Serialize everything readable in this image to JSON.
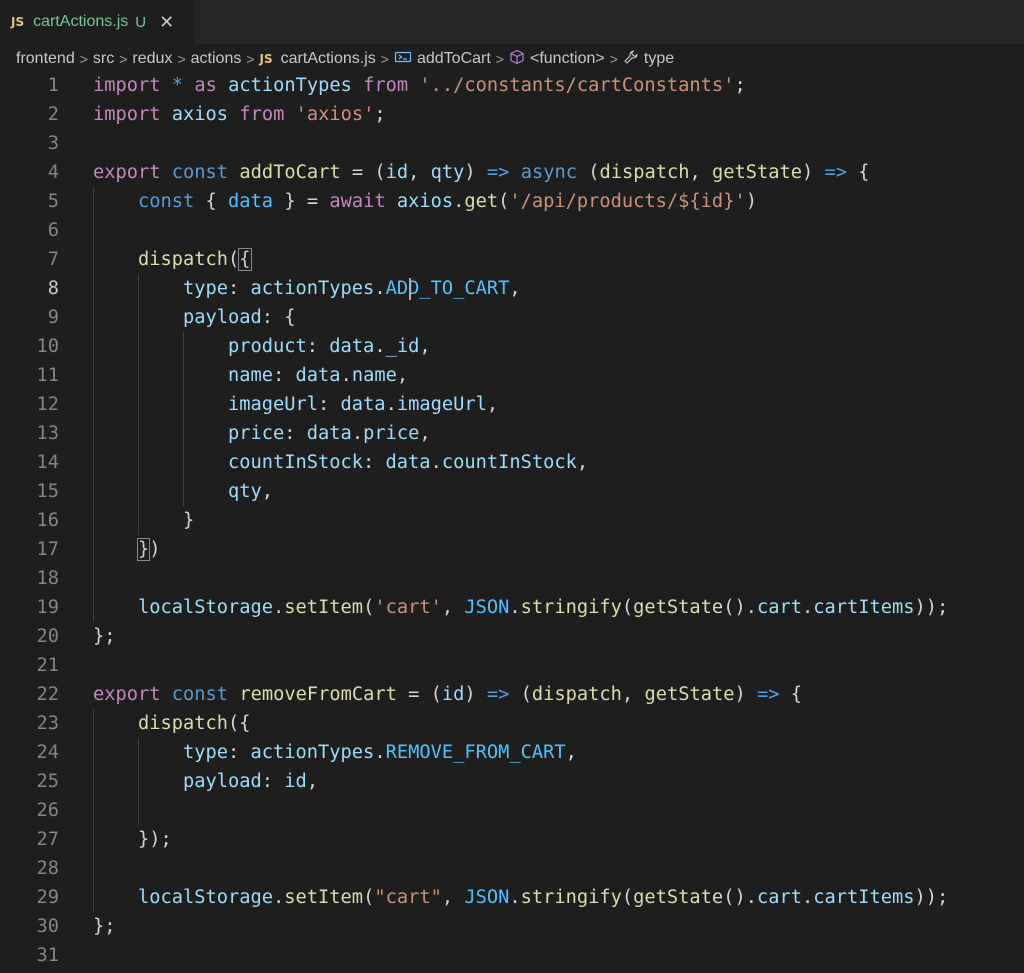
{
  "tab": {
    "lang": "JS",
    "filename": "cartActions.js",
    "status": "U",
    "close": "✕"
  },
  "breadcrumb": [
    "frontend",
    "src",
    "redux",
    "actions",
    "cartActions.js",
    "addToCart",
    "<function>",
    "type"
  ],
  "breadcrumb_sep": ">",
  "breadcrumb_js": "JS",
  "icons": {
    "symbol": "variable-icon",
    "function": "cube-icon",
    "property": "wrench-icon"
  },
  "editor": {
    "active_line": 8,
    "line_numbers": [
      "1",
      "2",
      "3",
      "4",
      "5",
      "6",
      "7",
      "8",
      "9",
      "10",
      "11",
      "12",
      "13",
      "14",
      "15",
      "16",
      "17",
      "18",
      "19",
      "20",
      "21",
      "22",
      "23",
      "24",
      "25",
      "26",
      "27",
      "28",
      "29",
      "30",
      "31"
    ],
    "lines": [
      [
        [
          "kw",
          "import"
        ],
        [
          "tx",
          " "
        ],
        [
          "sk",
          "*"
        ],
        [
          "tx",
          " "
        ],
        [
          "kw",
          "as"
        ],
        [
          "tx",
          " "
        ],
        [
          "vr",
          "actionTypes"
        ],
        [
          "tx",
          " "
        ],
        [
          "kw",
          "from"
        ],
        [
          "tx",
          " "
        ],
        [
          "str",
          "'../constants/cartConstants'"
        ],
        [
          "tx",
          ";"
        ]
      ],
      [
        [
          "kw",
          "import"
        ],
        [
          "tx",
          " "
        ],
        [
          "vr",
          "axios"
        ],
        [
          "tx",
          " "
        ],
        [
          "kw",
          "from"
        ],
        [
          "tx",
          " "
        ],
        [
          "str",
          "'axios'"
        ],
        [
          "tx",
          ";"
        ]
      ],
      [],
      [
        [
          "kw",
          "export"
        ],
        [
          "tx",
          " "
        ],
        [
          "sk",
          "const"
        ],
        [
          "tx",
          " "
        ],
        [
          "fn",
          "addToCart"
        ],
        [
          "tx",
          " = ("
        ],
        [
          "vr",
          "id"
        ],
        [
          "tx",
          ", "
        ],
        [
          "vr",
          "qty"
        ],
        [
          "tx",
          ") "
        ],
        [
          "sk",
          "=>"
        ],
        [
          "tx",
          " "
        ],
        [
          "sk",
          "async"
        ],
        [
          "tx",
          " ("
        ],
        [
          "fn",
          "dispatch"
        ],
        [
          "tx",
          ", "
        ],
        [
          "fn",
          "getState"
        ],
        [
          "tx",
          ") "
        ],
        [
          "sk",
          "=>"
        ],
        [
          "tx",
          " {"
        ]
      ],
      [
        [
          "tx",
          "    "
        ],
        [
          "sk",
          "const"
        ],
        [
          "tx",
          " { "
        ],
        [
          "cn",
          "data"
        ],
        [
          "tx",
          " } = "
        ],
        [
          "kw",
          "await"
        ],
        [
          "tx",
          " "
        ],
        [
          "vr",
          "axios"
        ],
        [
          "tx",
          "."
        ],
        [
          "fn",
          "get"
        ],
        [
          "tx",
          "("
        ],
        [
          "str",
          "'/api/products/${id}'"
        ],
        [
          "tx",
          ")"
        ]
      ],
      [],
      [
        [
          "tx",
          "    "
        ],
        [
          "fn",
          "dispatch"
        ],
        [
          "tx",
          "("
        ],
        [
          "bm",
          "{"
        ]
      ],
      [
        [
          "tx",
          "        "
        ],
        [
          "vr",
          "type"
        ],
        [
          "tx",
          ": "
        ],
        [
          "vr",
          "actionTypes"
        ],
        [
          "tx",
          "."
        ],
        [
          "cn",
          "ADD_TO_CART"
        ],
        [
          "tx",
          ","
        ]
      ],
      [
        [
          "tx",
          "        "
        ],
        [
          "vr",
          "payload"
        ],
        [
          "tx",
          ": {"
        ]
      ],
      [
        [
          "tx",
          "            "
        ],
        [
          "vr",
          "product"
        ],
        [
          "tx",
          ": "
        ],
        [
          "vr",
          "data"
        ],
        [
          "tx",
          "."
        ],
        [
          "vr",
          "_id"
        ],
        [
          "tx",
          ","
        ]
      ],
      [
        [
          "tx",
          "            "
        ],
        [
          "vr",
          "name"
        ],
        [
          "tx",
          ": "
        ],
        [
          "vr",
          "data"
        ],
        [
          "tx",
          "."
        ],
        [
          "vr",
          "name"
        ],
        [
          "tx",
          ","
        ]
      ],
      [
        [
          "tx",
          "            "
        ],
        [
          "vr",
          "imageUrl"
        ],
        [
          "tx",
          ": "
        ],
        [
          "vr",
          "data"
        ],
        [
          "tx",
          "."
        ],
        [
          "vr",
          "imageUrl"
        ],
        [
          "tx",
          ","
        ]
      ],
      [
        [
          "tx",
          "            "
        ],
        [
          "vr",
          "price"
        ],
        [
          "tx",
          ": "
        ],
        [
          "vr",
          "data"
        ],
        [
          "tx",
          "."
        ],
        [
          "vr",
          "price"
        ],
        [
          "tx",
          ","
        ]
      ],
      [
        [
          "tx",
          "            "
        ],
        [
          "vr",
          "countInStock"
        ],
        [
          "tx",
          ": "
        ],
        [
          "vr",
          "data"
        ],
        [
          "tx",
          "."
        ],
        [
          "vr",
          "countInStock"
        ],
        [
          "tx",
          ","
        ]
      ],
      [
        [
          "tx",
          "            "
        ],
        [
          "vr",
          "qty"
        ],
        [
          "tx",
          ","
        ]
      ],
      [
        [
          "tx",
          "        }"
        ]
      ],
      [
        [
          "tx",
          "    "
        ],
        [
          "bm",
          "}"
        ],
        [
          "tx",
          ")"
        ]
      ],
      [],
      [
        [
          "tx",
          "    "
        ],
        [
          "vr",
          "localStorage"
        ],
        [
          "tx",
          "."
        ],
        [
          "fn",
          "setItem"
        ],
        [
          "tx",
          "("
        ],
        [
          "str",
          "'cart'"
        ],
        [
          "tx",
          ", "
        ],
        [
          "cn",
          "JSON"
        ],
        [
          "tx",
          "."
        ],
        [
          "fn",
          "stringify"
        ],
        [
          "tx",
          "("
        ],
        [
          "fn",
          "getState"
        ],
        [
          "tx",
          "()."
        ],
        [
          "vr",
          "cart"
        ],
        [
          "tx",
          "."
        ],
        [
          "vr",
          "cartItems"
        ],
        [
          "tx",
          "));"
        ]
      ],
      [
        [
          "tx",
          "};"
        ]
      ],
      [],
      [
        [
          "kw",
          "export"
        ],
        [
          "tx",
          " "
        ],
        [
          "sk",
          "const"
        ],
        [
          "tx",
          " "
        ],
        [
          "fn",
          "removeFromCart"
        ],
        [
          "tx",
          " = ("
        ],
        [
          "vr",
          "id"
        ],
        [
          "tx",
          ") "
        ],
        [
          "sk",
          "=>"
        ],
        [
          "tx",
          " ("
        ],
        [
          "fn",
          "dispatch"
        ],
        [
          "tx",
          ", "
        ],
        [
          "fn",
          "getState"
        ],
        [
          "tx",
          ") "
        ],
        [
          "sk",
          "=>"
        ],
        [
          "tx",
          " {"
        ]
      ],
      [
        [
          "tx",
          "    "
        ],
        [
          "fn",
          "dispatch"
        ],
        [
          "tx",
          "({"
        ]
      ],
      [
        [
          "tx",
          "        "
        ],
        [
          "vr",
          "type"
        ],
        [
          "tx",
          ": "
        ],
        [
          "vr",
          "actionTypes"
        ],
        [
          "tx",
          "."
        ],
        [
          "cn",
          "REMOVE_FROM_CART"
        ],
        [
          "tx",
          ","
        ]
      ],
      [
        [
          "tx",
          "        "
        ],
        [
          "vr",
          "payload"
        ],
        [
          "tx",
          ": "
        ],
        [
          "vr",
          "id"
        ],
        [
          "tx",
          ","
        ]
      ],
      [],
      [
        [
          "tx",
          "    });"
        ]
      ],
      [],
      [
        [
          "tx",
          "    "
        ],
        [
          "vr",
          "localStorage"
        ],
        [
          "tx",
          "."
        ],
        [
          "fn",
          "setItem"
        ],
        [
          "tx",
          "("
        ],
        [
          "str",
          "\"cart\""
        ],
        [
          "tx",
          ", "
        ],
        [
          "cn",
          "JSON"
        ],
        [
          "tx",
          "."
        ],
        [
          "fn",
          "stringify"
        ],
        [
          "tx",
          "("
        ],
        [
          "fn",
          "getState"
        ],
        [
          "tx",
          "()."
        ],
        [
          "vr",
          "cart"
        ],
        [
          "tx",
          "."
        ],
        [
          "vr",
          "cartItems"
        ],
        [
          "tx",
          "));"
        ]
      ],
      [
        [
          "tx",
          "};"
        ]
      ],
      []
    ]
  },
  "colors": {
    "background": "#1e1e1e",
    "keyword": "#c586c0",
    "storage": "#569cd6",
    "function": "#dcdcaa",
    "variable": "#9cdcfe",
    "string": "#ce9178",
    "constant": "#4fc1ff",
    "text": "#d4d4d4"
  }
}
